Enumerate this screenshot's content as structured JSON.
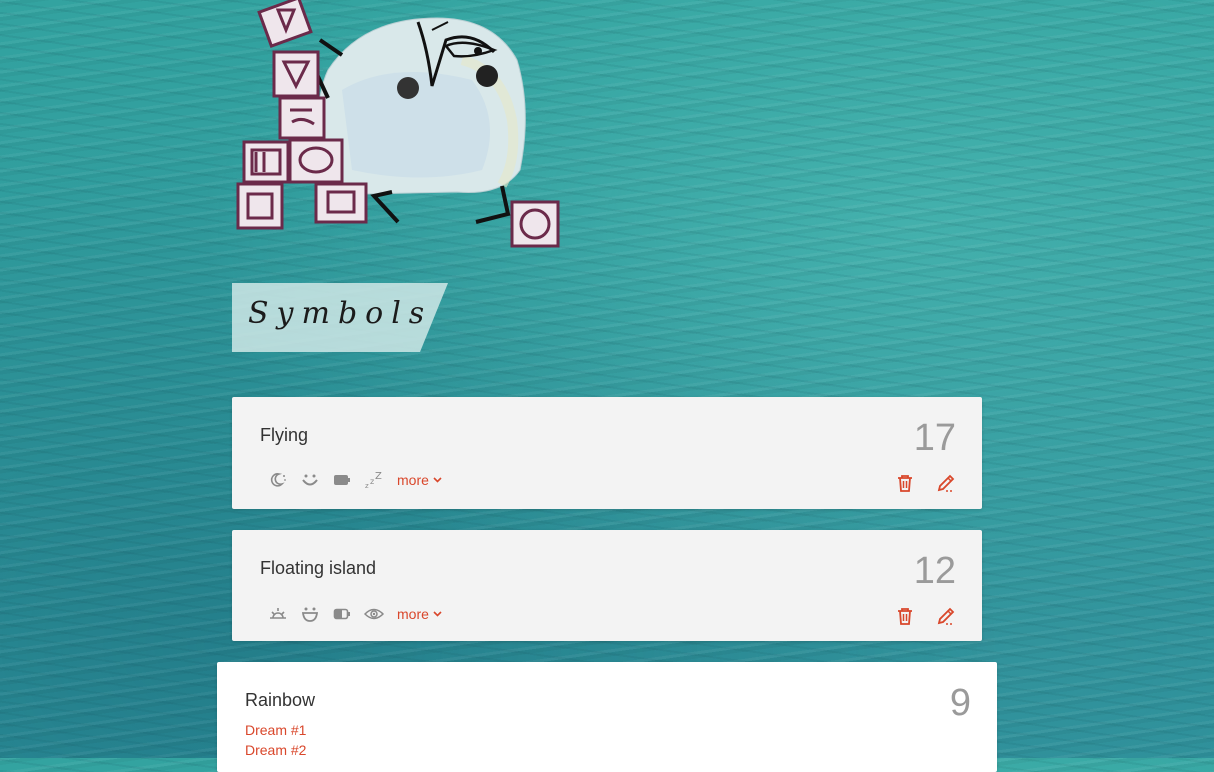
{
  "header": {
    "section_label": "Symbols"
  },
  "symbols": [
    {
      "title": "Flying",
      "count": "17",
      "icons": [
        "moon-stars-icon",
        "smile-icon",
        "battery-full-icon",
        "sleep-zzz-icon"
      ],
      "more_label": "more"
    },
    {
      "title": "Floating island",
      "count": "12",
      "icons": [
        "sunrise-icon",
        "grin-icon",
        "battery-half-icon",
        "eye-icon"
      ],
      "more_label": "more"
    },
    {
      "title": "Rainbow",
      "count": "9",
      "dreams": [
        "Dream #1",
        "Dream #2"
      ]
    }
  ],
  "colors": {
    "accent": "#d9472b",
    "card_bg": "#f3f3f3",
    "count_gray": "#9a9a9a",
    "icon_gray": "#8a8a8a"
  }
}
